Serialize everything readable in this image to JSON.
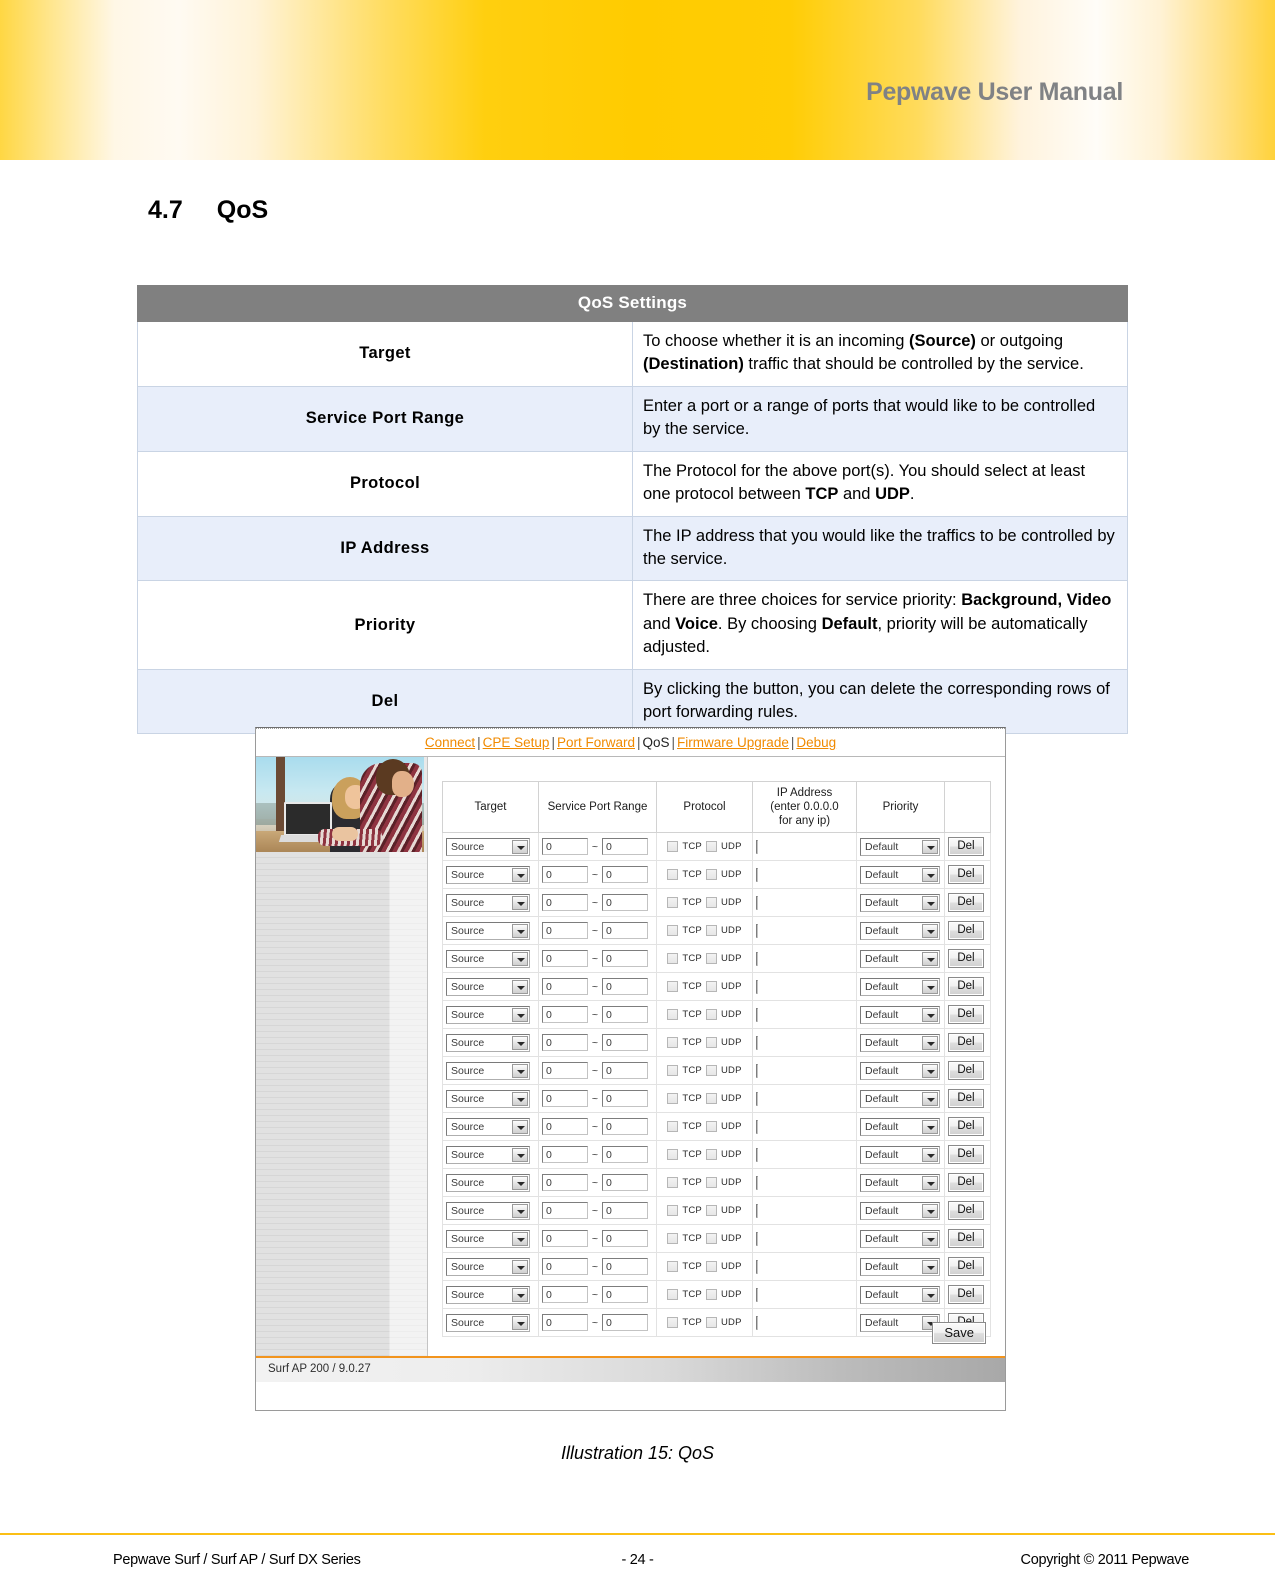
{
  "header": {
    "title": "Pepwave User Manual"
  },
  "section": {
    "number": "4.7",
    "title": "QoS"
  },
  "settings_table": {
    "title": "QoS Settings",
    "rows": [
      {
        "key": "Target",
        "value_html": "To choose whether it is an incoming <b>(Source)</b> or outgoing <b>(Destination)</b> traffic that should be controlled by the service.",
        "value_text": "To choose whether it is an incoming (Source) or outgoing (Destination) traffic that should be controlled by the service."
      },
      {
        "key": "Service Port Range",
        "value_html": "Enter a port or a range of ports that would like to be controlled by the service.",
        "value_text": "Enter a port or a range of ports that would like to be controlled by the service."
      },
      {
        "key": "Protocol",
        "value_html": "The Protocol for the above port(s). You should select at least one protocol between <b>TCP</b> and <b>UDP</b>.",
        "value_text": "The Protocol for the above port(s). You should select at least one protocol between TCP and UDP."
      },
      {
        "key": "IP Address",
        "value_html": "The IP address that you would like the traffics to be controlled by the service.",
        "value_text": "The IP address that you would like the traffics to be controlled by the service."
      },
      {
        "key": "Priority",
        "value_html": "There are three choices for service priority: <b>Background, Video</b> and <b>Voice</b>. By choosing <b>Default</b>, priority will be automatically adjusted.",
        "value_text": "There are three choices for service priority: Background, Video and Voice. By choosing Default, priority will be automatically adjusted."
      },
      {
        "key": "Del",
        "value_html": "By clicking the button, you can delete the corresponding rows of port forwarding rules.",
        "value_text": "By clicking the button, you can delete the corresponding rows of port forwarding rules."
      }
    ]
  },
  "screenshot": {
    "nav": {
      "items": [
        {
          "label": "Connect",
          "current": false
        },
        {
          "label": "CPE Setup",
          "current": false
        },
        {
          "label": "Port Forward",
          "current": false
        },
        {
          "label": "QoS",
          "current": true
        },
        {
          "label": "Firmware Upgrade",
          "current": false
        },
        {
          "label": "Debug",
          "current": false
        }
      ],
      "separator": "|"
    },
    "rules_table": {
      "headers": {
        "target": "Target",
        "service_port_range": "Service Port Range",
        "protocol": "Protocol",
        "ip_address_line1": "IP Address",
        "ip_address_line2": "(enter 0.0.0.0",
        "ip_address_line3": "for any ip)",
        "priority": "Priority",
        "action": ""
      },
      "row_defaults": {
        "target": "Source",
        "port_start": "0",
        "port_separator": "~",
        "port_end": "0",
        "tcp_label": "TCP",
        "udp_label": "UDP",
        "tcp_checked": false,
        "udp_checked": false,
        "ip_address": "",
        "priority": "Default",
        "del_label": "Del"
      },
      "row_count": 18
    },
    "save_label": "Save",
    "statusbar": "Surf AP 200 / 9.0.27",
    "accent_color": "#f2941d",
    "link_color": "#f08a00"
  },
  "caption": "Illustration 15: QoS",
  "footer": {
    "left": "Pepwave Surf / Surf AP / Surf DX Series",
    "center": "- 24 -",
    "right": "Copyright © 2011 Pepwave"
  }
}
